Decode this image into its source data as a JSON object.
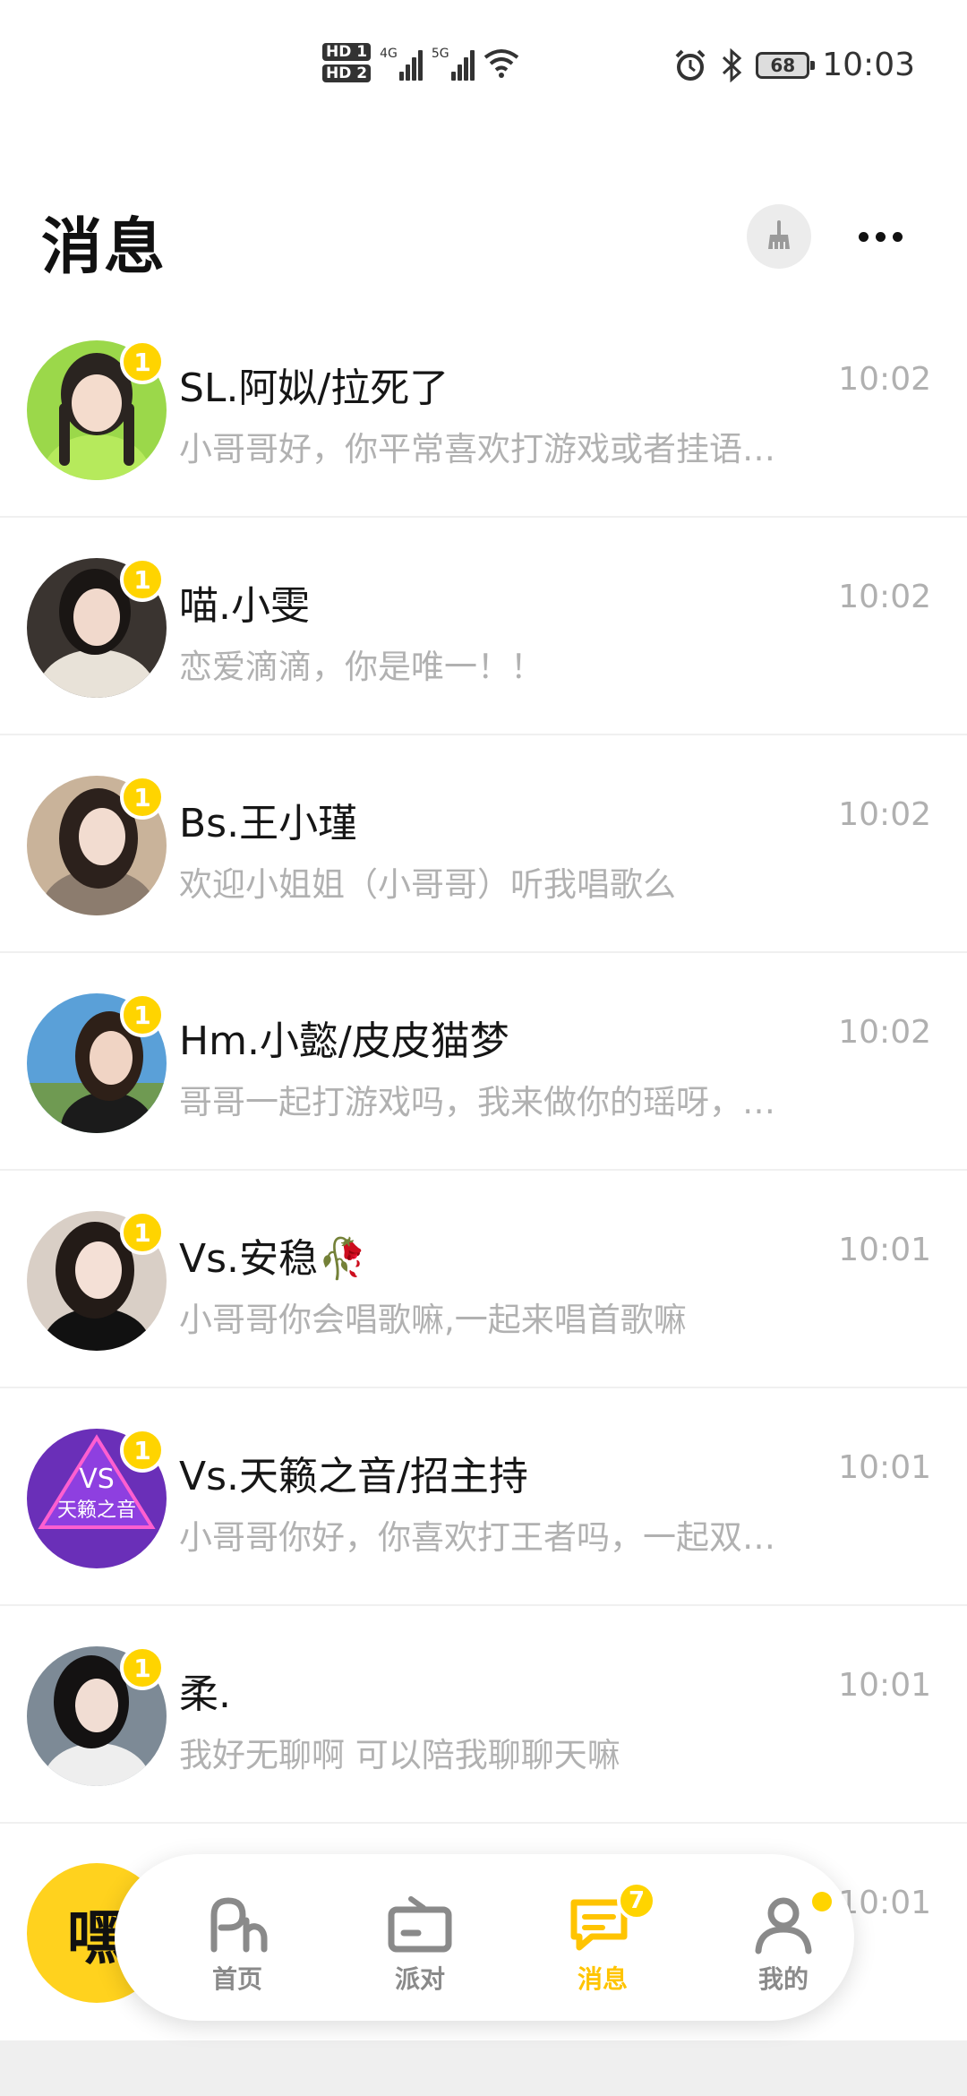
{
  "status_bar": {
    "hd1": "HD 1",
    "hd2": "HD 2",
    "net1": "4G",
    "net2": "5G",
    "battery": "68",
    "time": "10:03"
  },
  "header": {
    "title": "消息"
  },
  "conversations": [
    {
      "name": "SL.阿姒/拉死了",
      "preview": "小哥哥好，你平常喜欢打游戏或者挂语…",
      "time": "10:02",
      "unread": "1",
      "avatar_color": "#9bd84a"
    },
    {
      "name": "喵.小雯",
      "preview": "恋爱滴滴，你是唯一！！",
      "time": "10:02",
      "unread": "1",
      "avatar_color": "#3a3430"
    },
    {
      "name": "Bs.王小瑾",
      "preview": "欢迎小姐姐（小哥哥）听我唱歌么",
      "time": "10:02",
      "unread": "1",
      "avatar_color": "#c9b39a"
    },
    {
      "name": "Hm.小懿/皮皮猫梦",
      "preview": "哥哥一起打游戏吗，我来做你的瑶呀，…",
      "time": "10:02",
      "unread": "1",
      "avatar_color": "#5aa0d8"
    },
    {
      "name": "Vs.安稳🥀",
      "preview": "小哥哥你会唱歌嘛,一起来唱首歌嘛",
      "time": "10:01",
      "unread": "1",
      "avatar_color": "#d9cfc6"
    },
    {
      "name": "Vs.天籁之音/招主持",
      "preview": "小哥哥你好，你喜欢打王者吗，一起双…",
      "time": "10:01",
      "unread": "1",
      "avatar_color": "#6a2fb8",
      "avatar_text": "VS",
      "avatar_text2": "天籁之音"
    },
    {
      "name": "柔.",
      "preview": "我好无聊啊 可以陪我聊聊天嘛",
      "time": "10:01",
      "unread": "1",
      "avatar_color": "#7d8a96"
    }
  ],
  "partial_row": {
    "time": "10:01"
  },
  "fab": {
    "label": "嘿"
  },
  "tabs": [
    {
      "label": "首页"
    },
    {
      "label": "派对"
    },
    {
      "label": "消息",
      "badge": "7"
    },
    {
      "label": "我的"
    }
  ],
  "colors": {
    "accent": "#ffd400",
    "tab_active": "#ffc400",
    "muted_text": "#b1b1b1"
  }
}
